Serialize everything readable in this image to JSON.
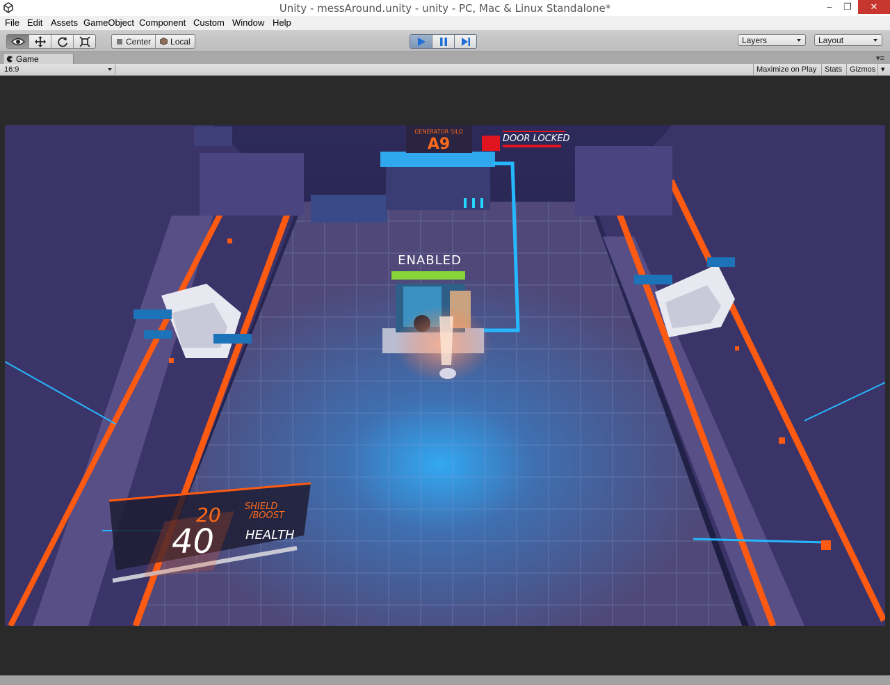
{
  "window": {
    "title": "Unity - messAround.unity - unity - PC, Mac & Linux Standalone*",
    "minimize": "‒",
    "restore": "❐",
    "close": "✕"
  },
  "menu": {
    "items": [
      "File",
      "Edit",
      "Assets",
      "GameObject",
      "Component",
      "Custom",
      "Window",
      "Help"
    ]
  },
  "toolbar": {
    "tools": [
      "eye-icon",
      "move-icon",
      "rotate-icon",
      "scale-icon"
    ],
    "pivot_label": "Center",
    "space_label": "Local",
    "layers_label": "Layers",
    "layout_label": "Layout",
    "play_state": "playing"
  },
  "game_tab": {
    "label": "Game",
    "aspect": "16:9",
    "maximize_on_play": "Maximize on Play",
    "stats": "Stats",
    "gizmos": "Gizmos"
  },
  "game_scene": {
    "sign_label": "GENERATOR SILO",
    "sign_code": "A9",
    "door_status": "DOOR LOCKED",
    "generator_status": "ENABLED",
    "shield_value": "20",
    "shield_label_line1": "SHIELD",
    "shield_label_line2": "/BOOST",
    "health_value": "40",
    "health_label": "HEALTH",
    "colors": {
      "orange": "#ff5a12",
      "cyan": "#26b8ff",
      "green": "#86d43a",
      "red": "#e0151f",
      "floor": "#5a4f82"
    }
  }
}
